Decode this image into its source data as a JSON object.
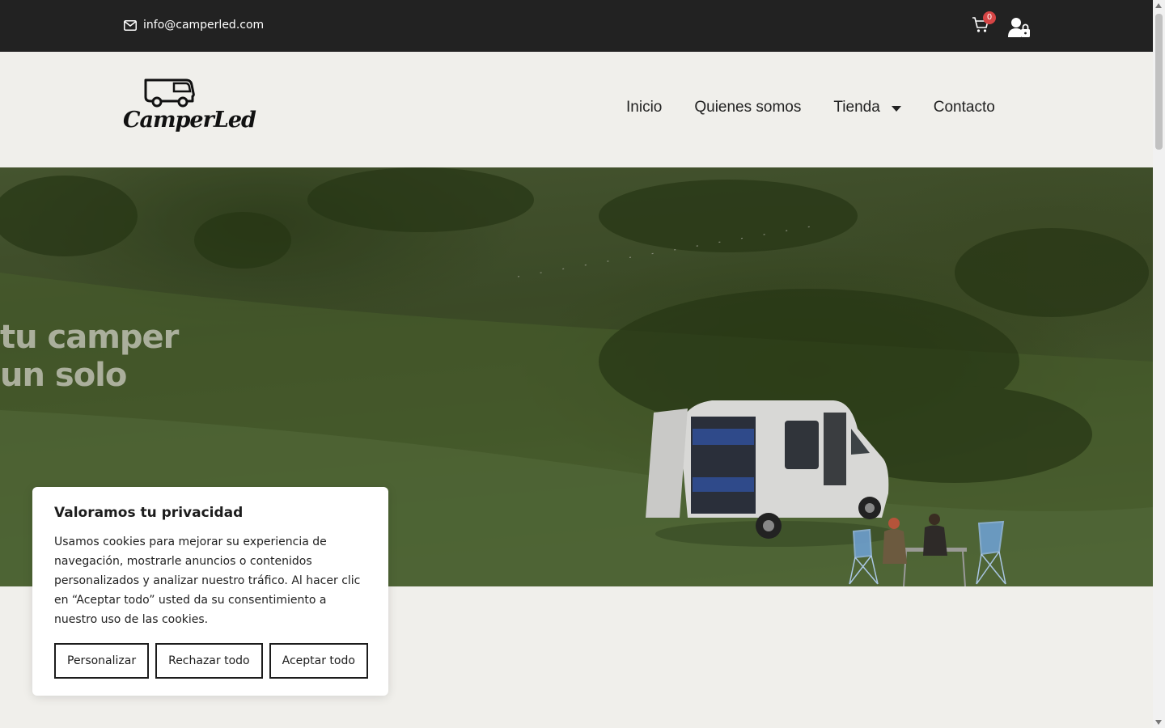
{
  "topbar": {
    "email": "info@camperled.com",
    "cart_count": "0",
    "icons": {
      "mail": "envelope-icon",
      "cart": "cart-icon",
      "account": "user-lock-icon"
    }
  },
  "header": {
    "logo_text": "CamperLed",
    "nav": [
      {
        "label": "Inicio"
      },
      {
        "label": "Quienes somos"
      },
      {
        "label": "Tienda",
        "has_dropdown": true
      },
      {
        "label": "Contacto"
      }
    ]
  },
  "hero": {
    "line1": "tu camper",
    "line2": "un solo"
  },
  "cookie_banner": {
    "title": "Valoramos tu privacidad",
    "body": "Usamos cookies para mejorar su experiencia de navegación, mostrarle anuncios o contenidos personalizados y analizar nuestro tráfico. Al hacer clic en “Aceptar todo” usted da su consentimiento a nuestro uso de las cookies.",
    "buttons": {
      "customize": "Personalizar",
      "reject": "Rechazar todo",
      "accept": "Aceptar todo"
    }
  },
  "colors": {
    "topbar_bg": "#222222",
    "header_bg": "#f0efeb",
    "badge": "#d64545",
    "text_dark": "#1c1c1c"
  }
}
